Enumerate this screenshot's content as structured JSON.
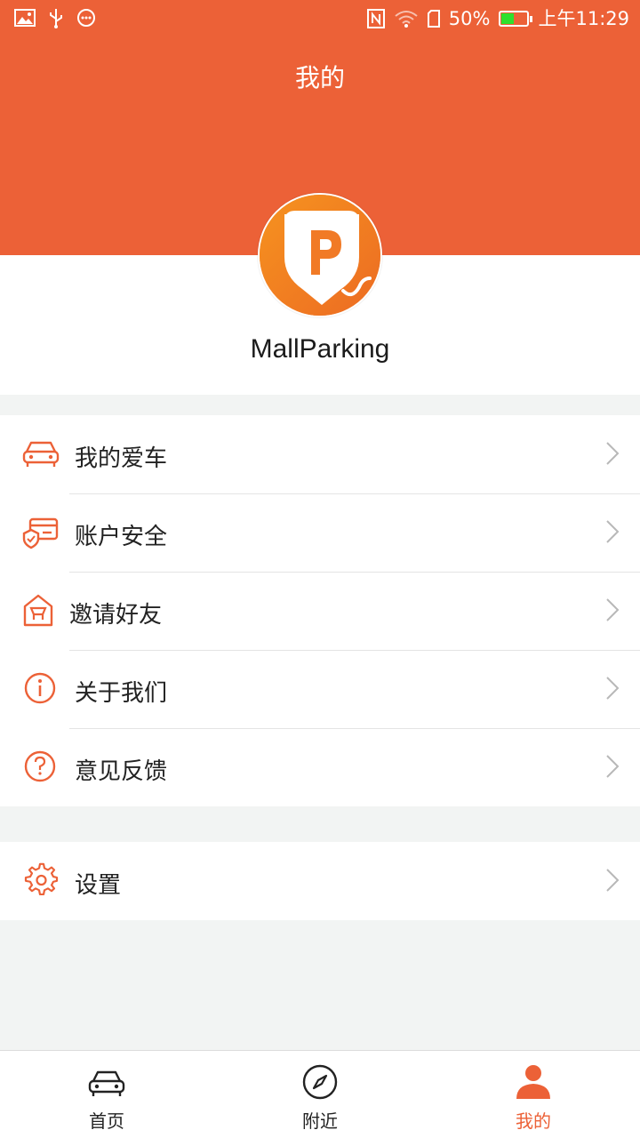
{
  "status_bar": {
    "battery_percent": "50%",
    "time": "上午11:29",
    "battery_level": 0.5
  },
  "header": {
    "title": "我的"
  },
  "profile": {
    "username": "MallParking"
  },
  "menu": {
    "items": [
      {
        "icon": "car-icon",
        "label": "我的爱车"
      },
      {
        "icon": "account-security-icon",
        "label": "账户安全"
      },
      {
        "icon": "invite-icon",
        "label": "邀请好友"
      },
      {
        "icon": "info-icon",
        "label": "关于我们"
      },
      {
        "icon": "question-icon",
        "label": "意见反馈"
      }
    ],
    "settings": {
      "icon": "gear-icon",
      "label": "设置"
    }
  },
  "tabbar": {
    "tabs": [
      {
        "icon": "car-icon",
        "label": "首页"
      },
      {
        "icon": "compass-icon",
        "label": "附近"
      },
      {
        "icon": "user-icon",
        "label": "我的",
        "active": true
      }
    ]
  },
  "colors": {
    "accent": "#ec6137",
    "logo": "#f17a26",
    "background": "#f2f4f3"
  }
}
